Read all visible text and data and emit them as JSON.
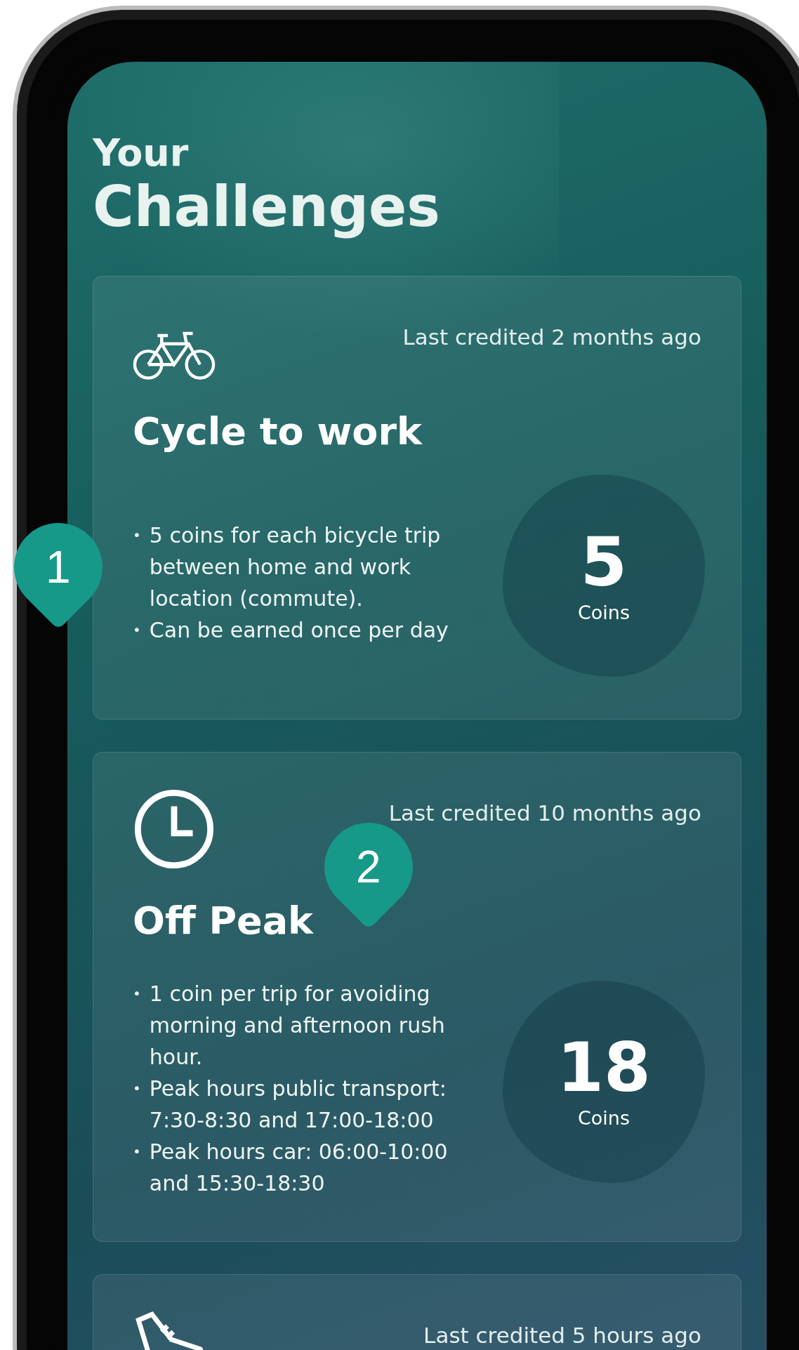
{
  "header": {
    "line_1": "Your",
    "line_2": "Challenges"
  },
  "challenges": [
    {
      "kind": "bicycle",
      "credited": "Last credited 2 months ago",
      "title": "Cycle to work",
      "bullets": [
        {
          "marker": "•",
          "text": "5 coins for each bicycle trip between home and work location (commute)."
        },
        {
          "marker": "•",
          "text": "Can be earned once per day"
        }
      ],
      "coins": "5",
      "coins_label": "Coins"
    },
    {
      "kind": "clock",
      "credited": "Last credited 10 months ago",
      "title": "Off Peak",
      "bullets": [
        {
          "marker": "•",
          "text": "1 coin per trip for avoiding morning and afternoon rush hour."
        },
        {
          "marker": "•",
          "text": "Peak hours public transport: 7:30-8:30 and 17:00-18:00"
        },
        {
          "marker": "•",
          "text": "Peak hours car: 06:00-10:00 and 15:30-18:30"
        }
      ],
      "coins": "18",
      "coins_label": "Coins"
    },
    {
      "kind": "shoe",
      "credited": "Last credited 5 hours ago"
    }
  ],
  "callouts": [
    {
      "number": "1"
    },
    {
      "number": "2"
    }
  ]
}
